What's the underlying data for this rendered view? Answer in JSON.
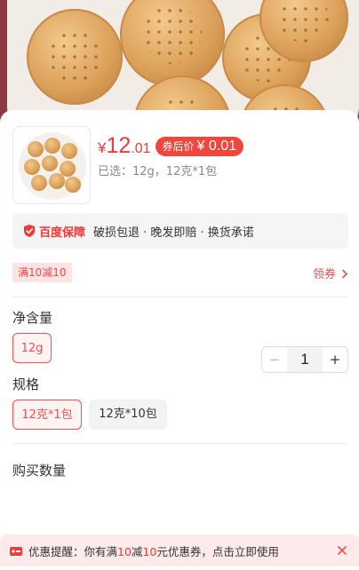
{
  "product": {
    "price_currency": "¥",
    "price_integer": "12",
    "price_decimal": ".01",
    "coupon_price_label": "券后价",
    "coupon_price_value": "¥ 0.01",
    "selected_text": "已选：12g，12克*1包"
  },
  "guarantee": {
    "brand": "百度保障",
    "items": "破损包退 · 晚发即赔 · 换货承诺"
  },
  "discount": {
    "tag": "满10减10",
    "get_coupon": "领券"
  },
  "spec_groups": [
    {
      "title": "净含量",
      "options": [
        {
          "label": "12g",
          "selected": true
        }
      ]
    },
    {
      "title": "规格",
      "options": [
        {
          "label": "12克*1包",
          "selected": true
        },
        {
          "label": "12克*10包",
          "selected": false
        }
      ]
    }
  ],
  "quantity": {
    "label": "购买数量",
    "minus": "−",
    "value": "1",
    "plus": "+"
  },
  "notice": {
    "prefix": "优惠提醒：你有满",
    "amount1": "10",
    "mid1": "减",
    "amount2": "10",
    "suffix": "元优惠券，点击立即使用"
  },
  "colors": {
    "accent": "#f03a3a",
    "hero_background": "#8b3a42"
  },
  "icons": [
    "close-icon",
    "shield-icon",
    "chevron-right-icon",
    "bell-icon",
    "small-close-icon"
  ]
}
